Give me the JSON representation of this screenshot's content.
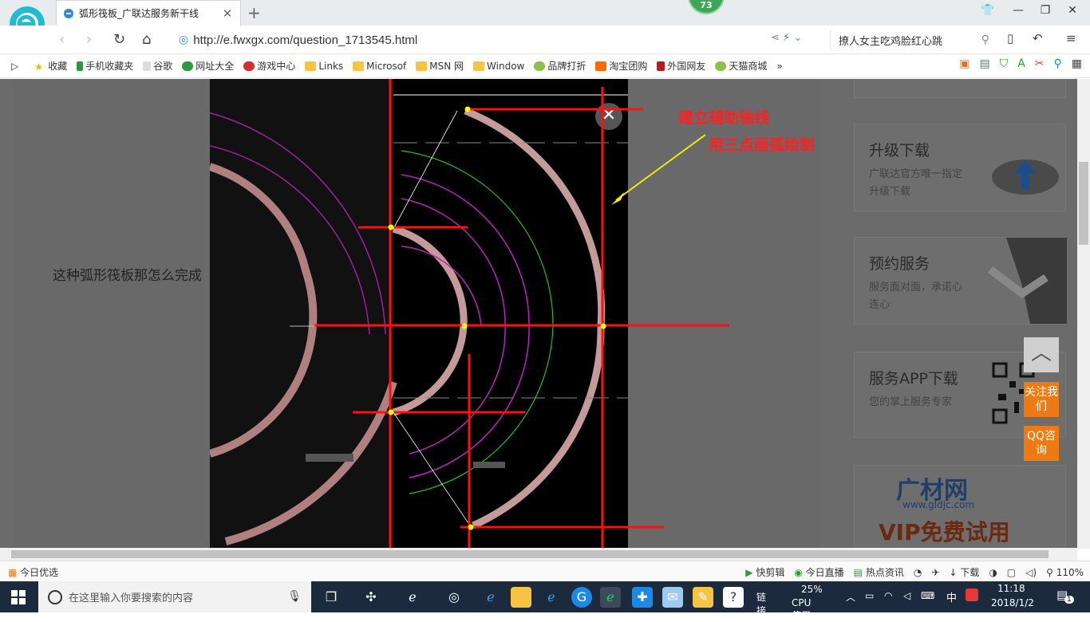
{
  "browser": {
    "tab_title": "弧形筏板_广联达服务新干线",
    "badge_count": "73",
    "url": "http://e.fwxgx.com/question_1713545.html",
    "search_text": "撩人女主吃鸡脸红心跳"
  },
  "favorites": [
    "收藏",
    "手机收藏夹",
    "谷歌",
    "网址大全",
    "游戏中心",
    "Links",
    "Microsof",
    "MSN 网",
    "Window",
    "品牌打折",
    "淘宝团购",
    "外国网友",
    "天猫商城"
  ],
  "page": {
    "question_text": "这种弧形筏板那怎么完成",
    "annotation_1": "建立辅助轴线",
    "annotation_2": "用三点画弧绘制",
    "sidebar": [
      {
        "title": "升级下载",
        "desc": "广联达官方唯一指定升级下载"
      },
      {
        "title": "预约服务",
        "desc": "服务面对面，承诺心连心"
      },
      {
        "title": "服务APP下载",
        "desc": "您的掌上服务专家"
      }
    ],
    "float_follow": "关注我们",
    "float_qq": "QQ咨询",
    "ad_brand": "广材网",
    "ad_site": "www.gldjc.com",
    "ad_slogan": "VIP免费试用"
  },
  "statusbar": {
    "left": "今日优选",
    "items": [
      "快剪辑",
      "今日直播",
      "热点资讯",
      "下载"
    ],
    "zoom": "110%"
  },
  "taskbar": {
    "search_placeholder": "在这里输入你要搜索的内容",
    "link_label": "链接",
    "cpu_percent": "25%",
    "cpu_label": "CPU使用",
    "ime": "中",
    "time": "11:18",
    "date": "2018/1/2",
    "notif_count": "1"
  },
  "colors": {
    "accent_red": "#ff2020",
    "float_orange": "#f07a12",
    "taskbar": "#1c2a3e"
  }
}
